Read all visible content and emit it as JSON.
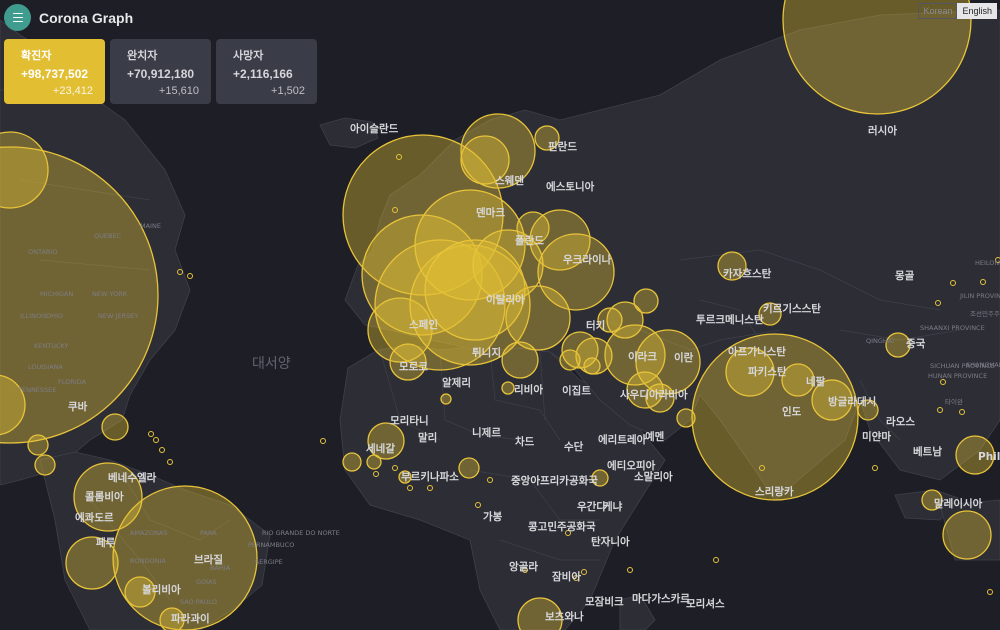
{
  "app": {
    "title": "Corona Graph"
  },
  "language": {
    "options": [
      "Korean",
      "English"
    ],
    "selected": "English"
  },
  "stats": [
    {
      "title": "확진자",
      "total": "+98,737,502",
      "delta": "+23,412",
      "active": true
    },
    {
      "title": "완치자",
      "total": "+70,912,180",
      "delta": "+15,610",
      "active": false
    },
    {
      "title": "사망자",
      "total": "+2,116,166",
      "delta": "+1,502",
      "active": false
    }
  ],
  "map": {
    "colors": {
      "background": "#1e1f26",
      "land": "#2c2d35",
      "bubble": "#e8c43a",
      "accent": "#3f9c8f"
    },
    "ocean_labels": [
      "대서양"
    ],
    "country_labels": [
      "아이슬란드",
      "핀란드",
      "스웨덴",
      "에스토니아",
      "덴마크",
      "폴란드",
      "우크라이나",
      "이탈리아",
      "스페인",
      "터키",
      "튀니지",
      "모로코",
      "알제리",
      "리비아",
      "이집트",
      "사우디아라비아",
      "이라크",
      "이란",
      "투르크메니스탄",
      "카자흐스탄",
      "키르기스스탄",
      "아프가니스탄",
      "파키스탄",
      "인도",
      "네팔",
      "방글라데시",
      "미얀마",
      "라오스",
      "베트남",
      "Philippines",
      "말레이시아",
      "러시아",
      "몽골",
      "중국",
      "모리타니",
      "말리",
      "니제르",
      "차드",
      "수단",
      "에리트레아",
      "예멘",
      "에티오피아",
      "소말리아",
      "세네갈",
      "부르키나파소",
      "중앙아프리카공화국",
      "가봉",
      "콩고민주공화국",
      "우간다",
      "케냐",
      "탄자니아",
      "앙골라",
      "잠비아",
      "모잠비크",
      "마다가스카르",
      "모리셔스",
      "보츠와나",
      "쿠바",
      "베네수엘라",
      "콜롬비아",
      "에콰도르",
      "페루",
      "브라질",
      "볼리비아",
      "파라과이",
      "스리랑카"
    ],
    "region_labels": [
      "QUEBEC",
      "ONTARIO",
      "MAINE",
      "MICHIGAN",
      "NEW YORK",
      "ILLINOIS",
      "OHIO",
      "NEW JERSEY",
      "KENTUCKY",
      "TENNESSEE",
      "LOUISIANA",
      "FLORIDA",
      "AMAZONAS",
      "PARA",
      "RONDONIA",
      "BAHIA",
      "GOIAS",
      "RIO GRANDE DO NORTE",
      "PERNAMBUCO",
      "SERGIPE",
      "SAO PAULO",
      "QINGHAI",
      "SHAANXI PROVINCE",
      "SICHUAN PROVINCE",
      "HUNAN PROVINCE",
      "SHANGHAI",
      "HEILONGJIANG PROVINCE",
      "JILIN PROVINCE",
      "조선민주주의",
      "타이완"
    ]
  }
}
